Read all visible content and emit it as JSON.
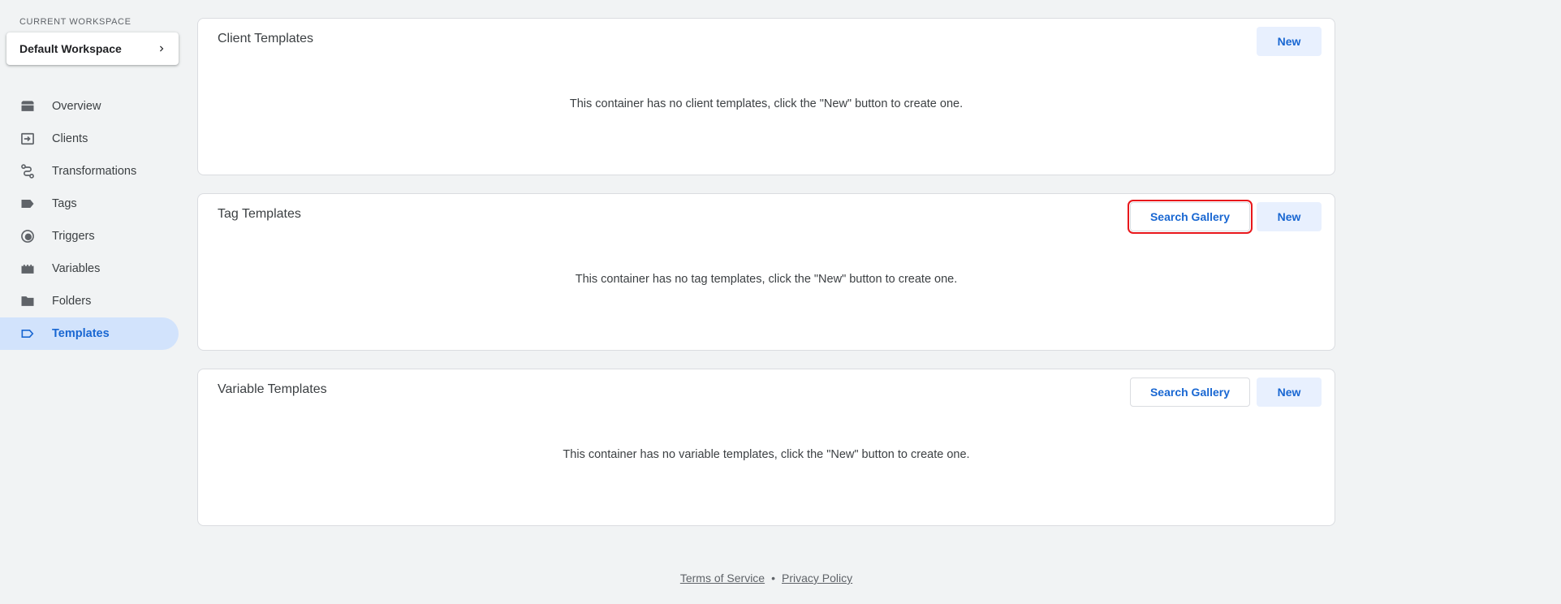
{
  "workspace": {
    "label": "CURRENT WORKSPACE",
    "name": "Default Workspace"
  },
  "nav": {
    "items": [
      {
        "label": "Overview",
        "icon": "briefcase-icon"
      },
      {
        "label": "Clients",
        "icon": "login-icon"
      },
      {
        "label": "Transformations",
        "icon": "route-icon"
      },
      {
        "label": "Tags",
        "icon": "label-icon"
      },
      {
        "label": "Triggers",
        "icon": "trigger-icon"
      },
      {
        "label": "Variables",
        "icon": "variables-icon"
      },
      {
        "label": "Folders",
        "icon": "folder-icon"
      },
      {
        "label": "Templates",
        "icon": "label-outline-icon",
        "active": true
      }
    ]
  },
  "cards": {
    "client": {
      "title": "Client Templates",
      "empty": "This container has no client templates, click the \"New\" button to create one.",
      "new_label": "New"
    },
    "tag": {
      "title": "Tag Templates",
      "empty": "This container has no tag templates, click the \"New\" button to create one.",
      "gallery_label": "Search Gallery",
      "new_label": "New"
    },
    "variable": {
      "title": "Variable Templates",
      "empty": "This container has no variable templates, click the \"New\" button to create one.",
      "gallery_label": "Search Gallery",
      "new_label": "New"
    }
  },
  "footer": {
    "terms": "Terms of Service",
    "separator": "•",
    "privacy": "Privacy Policy"
  },
  "colors": {
    "accent": "#1967d2",
    "active_bg": "#d2e3fc",
    "highlight": "#e8171b"
  }
}
